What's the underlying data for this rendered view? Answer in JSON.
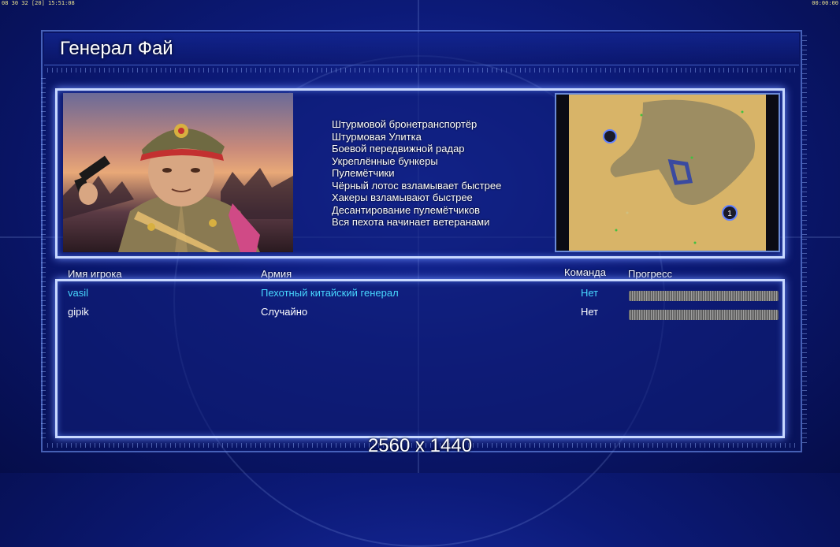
{
  "hud": {
    "left": "08 30 32 [20] 15:51:08",
    "right": "00:00:00"
  },
  "title": "Генерал Фай",
  "perks": [
    "Штурмовой бронетранспортёр",
    "Штурмовая Улитка",
    "Боевой передвижной радар",
    "Укреплённые бункеры",
    "Пулемётчики",
    "Чёрный лотос взламывает быстрее",
    "Хакеры взламывают быстрее",
    "Десантирование пулемётчиков",
    "Вся пехота начинает ветеранами"
  ],
  "minimap": {
    "start_marker": "1"
  },
  "table": {
    "headers": {
      "player": "Имя игрока",
      "army": "Армия",
      "team": "Команда",
      "progress": "Прогресс"
    },
    "rows": [
      {
        "player": "vasil",
        "army": "Пехотный китайский генерал",
        "team": "Нет",
        "color": "#48d8ff"
      },
      {
        "player": "gipik",
        "army": "Случайно",
        "team": "Нет",
        "color": "#ffffff"
      }
    ]
  },
  "resolution_label": "2560 x 1440",
  "colors": {
    "accent": "#c8d8ff",
    "highlight_player": "#48d8ff",
    "background": "#0c1a78"
  }
}
